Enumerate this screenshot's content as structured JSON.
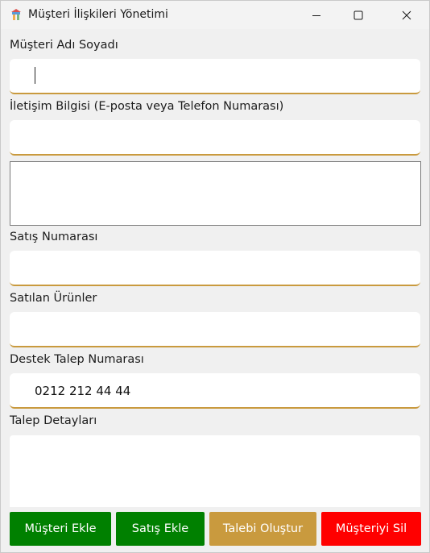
{
  "window": {
    "title": "Müşteri İlişkileri Yönetimi",
    "app_icon": "app-icon",
    "controls": [
      "minimize-icon",
      "maximize-icon",
      "close-icon"
    ]
  },
  "form": {
    "customer_name": {
      "label": "Müşteri Adı Soyadı",
      "value": ""
    },
    "contact_info": {
      "label": "İletişim Bilgisi (E-posta veya Telefon Numarası)",
      "value": ""
    },
    "sale_number": {
      "label": "Satış Numarası",
      "value": ""
    },
    "sold_products": {
      "label": "Satılan Ürünler",
      "value": ""
    },
    "support_ticket_number": {
      "label": "Destek Talep Numarası",
      "value": "0212 212 44 44"
    },
    "ticket_details": {
      "label": "Talep Detayları",
      "value": ""
    }
  },
  "buttons": {
    "add_customer": "Müşteri Ekle",
    "add_sale": "Satış Ekle",
    "create_ticket": "Talebi Oluştur",
    "delete_customer": "Müşteriyi Sil"
  },
  "colors": {
    "add_customer": "#008000",
    "add_sale": "#008000",
    "create_ticket": "#c99a3e",
    "delete_customer": "#ff0000",
    "field_underline": "#c99a3e"
  }
}
